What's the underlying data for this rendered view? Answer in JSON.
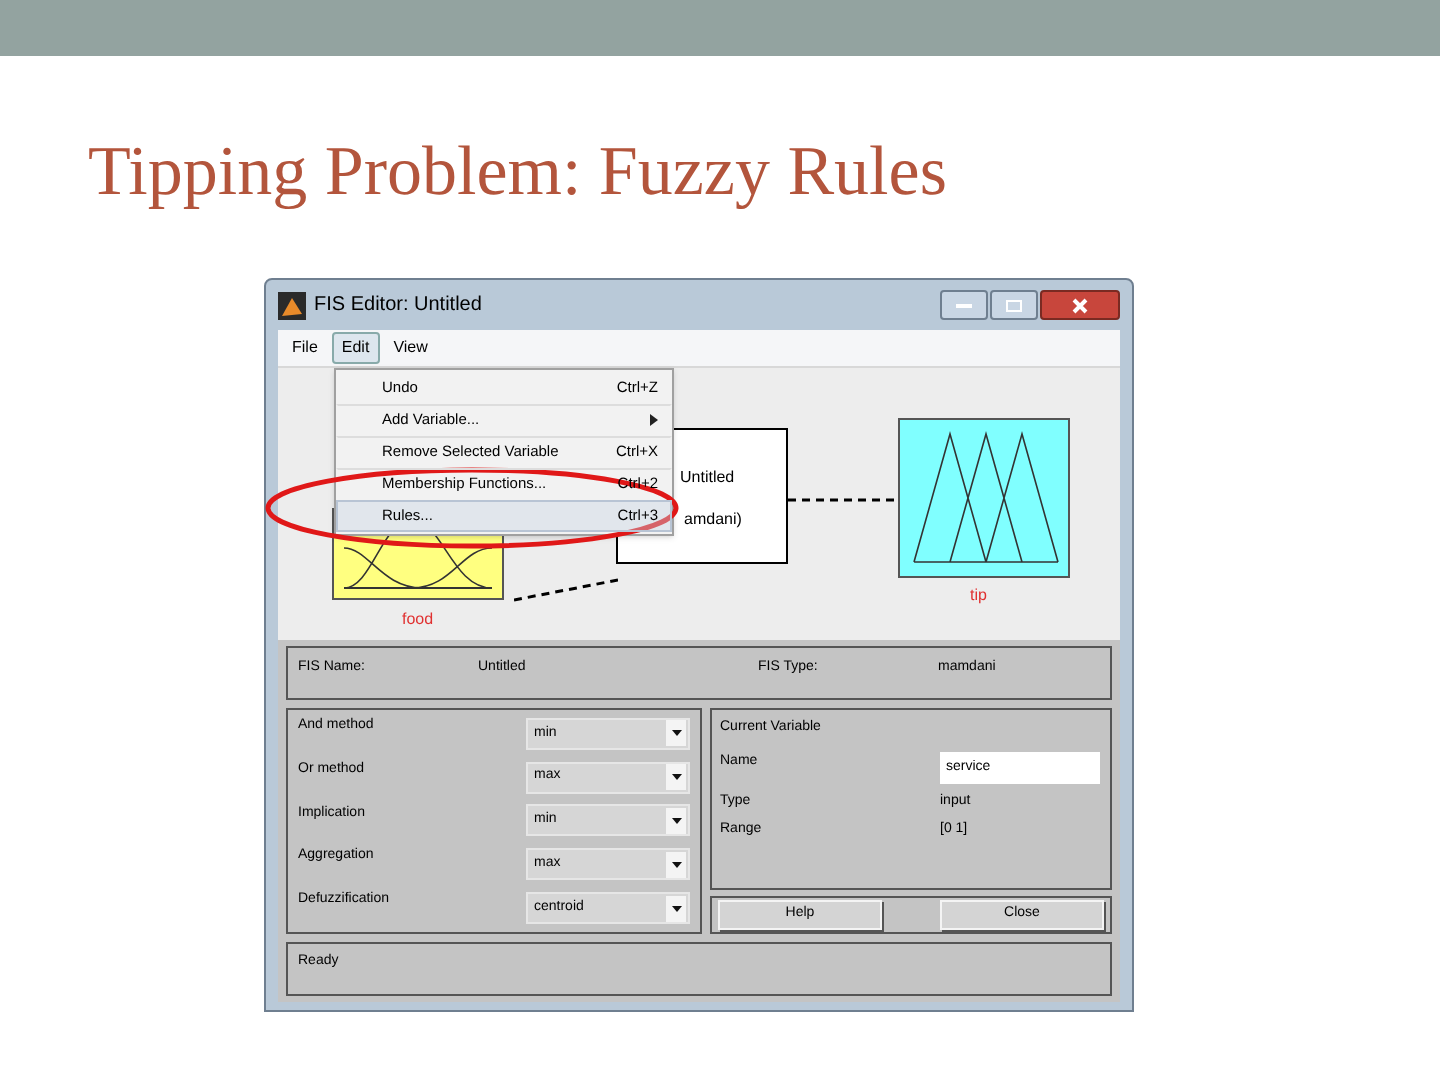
{
  "slide_title": "Tipping Problem: Fuzzy Rules",
  "window": {
    "title": "FIS Editor: Untitled"
  },
  "menubar": [
    {
      "label": "File",
      "selected": false
    },
    {
      "label": "Edit",
      "selected": true
    },
    {
      "label": "View",
      "selected": false
    }
  ],
  "edit_menu": [
    {
      "label": "Undo",
      "shortcut": "Ctrl+Z",
      "submenu": false,
      "selected": false
    },
    {
      "label": "Add Variable...",
      "submenu": true,
      "selected": false
    },
    {
      "label": "Remove Selected Variable",
      "shortcut": "Ctrl+X",
      "submenu": false,
      "selected": false
    },
    {
      "label": "Membership Functions...",
      "shortcut": "Ctrl+2",
      "submenu": false,
      "selected": false
    },
    {
      "label": "Rules...",
      "shortcut": "Ctrl+3",
      "submenu": false,
      "selected": true
    }
  ],
  "diagram": {
    "input": "food",
    "system_lines": [
      "Untitled",
      "amdani)"
    ],
    "output": "tip"
  },
  "fis_info": [
    {
      "label": "FIS Name:",
      "value": "Untitled"
    },
    {
      "label": "FIS Type:",
      "value": "mamdani"
    }
  ],
  "methods": [
    {
      "label": "And method",
      "value": "min"
    },
    {
      "label": "Or method",
      "value": "max"
    },
    {
      "label": "Implication",
      "value": "min"
    },
    {
      "label": "Aggregation",
      "value": "max"
    },
    {
      "label": "Defuzzification",
      "value": "centroid"
    }
  ],
  "current_variable": {
    "heading": "Current Variable",
    "name_label": "Name",
    "name_value": "service",
    "type_label": "Type",
    "type_value": "input",
    "range_label": "Range",
    "range_value": "[0 1]"
  },
  "buttons": [
    "Help",
    "Close"
  ],
  "status_bar": "Ready"
}
